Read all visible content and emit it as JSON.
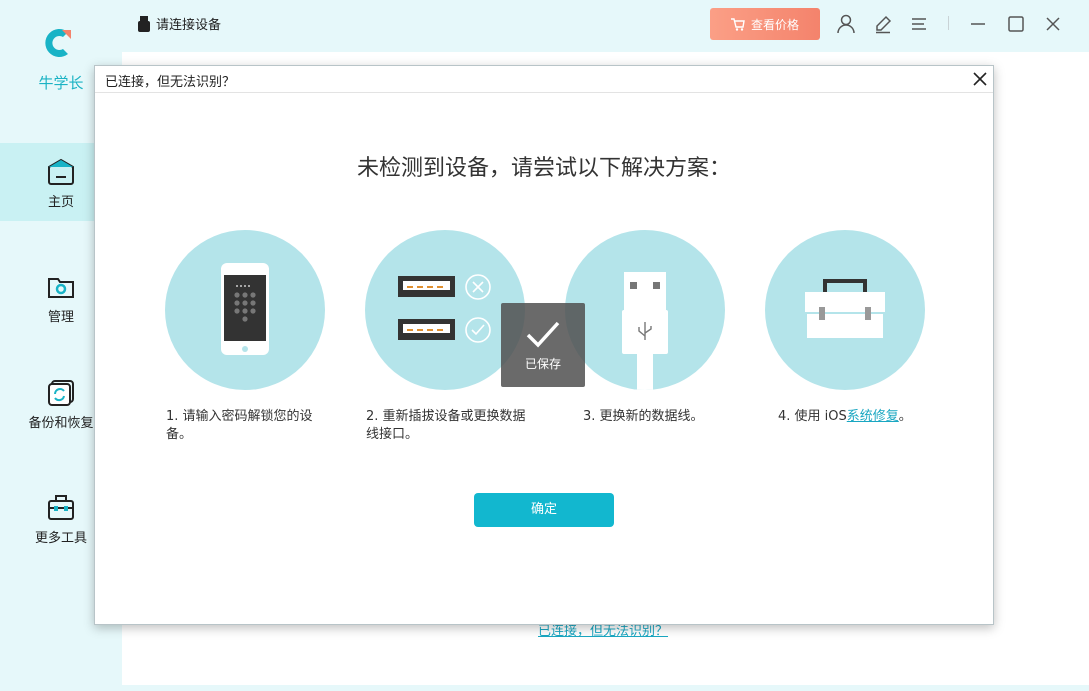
{
  "sidebar": {
    "brand": "牛学长",
    "items": [
      {
        "label": "主页",
        "icon": "home-icon"
      },
      {
        "label": "管理",
        "icon": "folder-gear-icon"
      },
      {
        "label": "备份和恢复",
        "icon": "backup-restore-icon"
      },
      {
        "label": "更多工具",
        "icon": "toolbox-icon"
      }
    ]
  },
  "header": {
    "status": "请连接设备",
    "price_button": "查看价格"
  },
  "background": {
    "link": "已连接，但无法识别？"
  },
  "dialog": {
    "title": "已连接，但无法识别？",
    "heading": "未检测到设备，请尝试以下解决方案：",
    "steps": [
      {
        "text": "1. 请输入密码解锁您的设备。"
      },
      {
        "text": "2. 重新插拔设备或更换数据线接口。"
      },
      {
        "text": "3. 更换新的数据线。"
      },
      {
        "prefix": "4. 使用 iOS",
        "link": "系统修复",
        "suffix": "。"
      }
    ],
    "toast": "已保存",
    "ok_button": "确定"
  },
  "colors": {
    "accent": "#12b7cf",
    "brand": "#1bb3c4",
    "price": "#f4836c",
    "circle": "#b4e4ea"
  }
}
